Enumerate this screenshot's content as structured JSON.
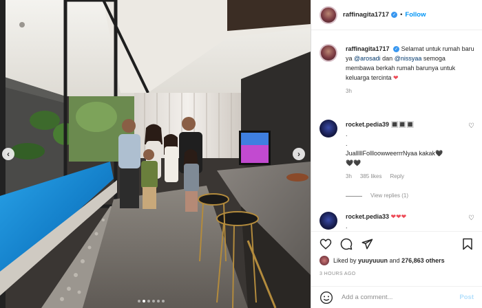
{
  "header": {
    "username": "raffinagita1717",
    "follow_sep": "•",
    "follow_label": "Follow"
  },
  "caption": {
    "username": "raffinagita1717",
    "text_1": "Selamat untuk rumah baru ya ",
    "mention_1": "@arosadi",
    "text_2": " dan ",
    "mention_2": "@nissyaa",
    "text_3": " semoga membawa berkah rumah barunya untuk keluarga tercinta ",
    "heart": "❤",
    "time": "3h"
  },
  "comments": [
    {
      "username": "rocket.pedia39",
      "text_1": "🔳🔳🔳",
      "text_2": ".",
      "text_3": ".",
      "text_4": "JualllllFollloowweerrrNyaa kakak🖤",
      "text_5": "🖤🖤",
      "time": "3h",
      "likes": "385 likes",
      "reply": "Reply",
      "view_replies": "View replies (1)"
    },
    {
      "username": "rocket.pedia33",
      "text_1": "❤❤❤",
      "text_2": "."
    }
  ],
  "likes": {
    "text_prefix": "Liked by ",
    "user": "yuuyuuun",
    "text_mid": " and ",
    "count": "276,863 others"
  },
  "timestamp": "3 HOURS AGO",
  "add_comment": {
    "placeholder": "Add a comment...",
    "post_label": "Post"
  },
  "colors": {
    "accent": "#0095f6",
    "verified": "#3897f0",
    "heart": "#ed4956",
    "post_disabled": "#b2dffc"
  },
  "icons": {
    "like": "heart-outline-icon",
    "comment": "comment-bubble-icon",
    "share": "paper-plane-icon",
    "save": "bookmark-icon",
    "emoji": "smiley-icon",
    "prev": "chevron-left-icon",
    "next": "chevron-right-icon"
  },
  "carousel": {
    "total": 6,
    "active_index": 1
  }
}
